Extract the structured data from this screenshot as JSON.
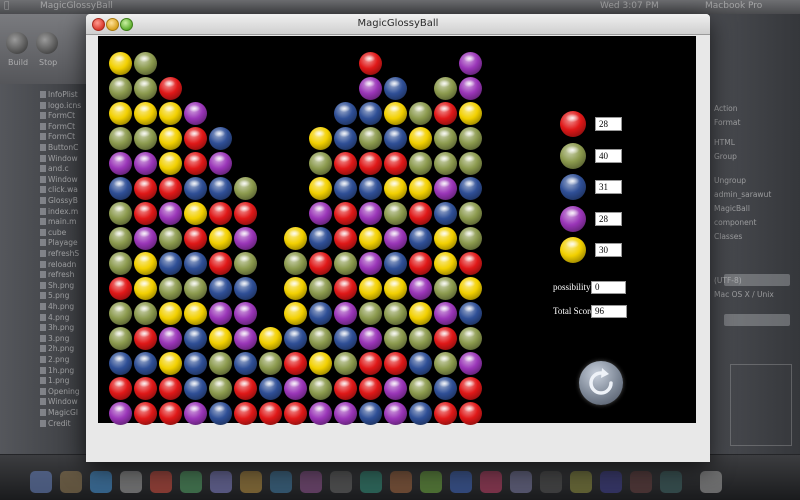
{
  "window": {
    "title": "MagicGlossyBall"
  },
  "menubar": {
    "clock": "Wed 3:07 PM",
    "machine": "Macbook Pro"
  },
  "colors": {
    "yellow": "#f2d000",
    "green": "#8c9a4e",
    "red": "#e01818",
    "blue": "#2f4f96",
    "purple": "#9a35b8"
  },
  "legend": [
    {
      "color": "red",
      "count": "28"
    },
    {
      "color": "green",
      "count": "40"
    },
    {
      "color": "blue",
      "count": "31"
    },
    {
      "color": "purple",
      "count": "28"
    },
    {
      "color": "yellow",
      "count": "30"
    }
  ],
  "status": {
    "possibility_label": "possibility:",
    "possibility_value": "0",
    "score_label": "Total Score:",
    "score_value": "96"
  },
  "board": {
    "cols": 15,
    "rows": 15,
    "columns": [
      "YGYGPBGGGRGGBRP",
      "GGYGPRRPYYGRBRR",
      "RYYYRPGBGYPYRR",
      "PRRBYRBGYBBBP",
      "BPBRYRBPYGGB",
      "GRPGBPPBRR",
      "YGBR",
      "YGYYBRPR",
      "YGYPBRGBGYGP",
      "BBRBRRGRPBGRP",
      "RPBGRBPYPYGPRRB",
      "BYBRYGPBYGGRPP",
      "GYGYRBRPYGBGB",
      "GRGGPBYYGPRGBR",
      "PPYGGBGGRYBGPRR"
    ]
  },
  "background_left": {
    "toolbar": [
      "Build",
      "Stop"
    ],
    "files": [
      "InfoPlist",
      "logo.icns",
      "FormCt",
      "FormCt",
      "FormCt",
      "ButtonC",
      "Window",
      "and.c",
      "Window",
      "click.wa",
      "GlossyB",
      "index.m",
      "main.m",
      "cube",
      "Playage",
      "refreshS",
      "reloadn",
      "refresh",
      "Sh.png",
      "5.png",
      "4h.png",
      "4.png",
      "3h.png",
      "3.png",
      "2h.png",
      "2.png",
      "1h.png",
      "1.png",
      "Opening",
      "Window",
      "MagicGl",
      "Credit"
    ]
  },
  "background_right": {
    "rows": [
      "Action",
      "Format",
      "HTML",
      "Group",
      "Ungroup",
      "admin_sarawut",
      "MagicBall",
      "component",
      "Classes",
      "(UTF-8)",
      "Mac OS X / Unix"
    ]
  }
}
